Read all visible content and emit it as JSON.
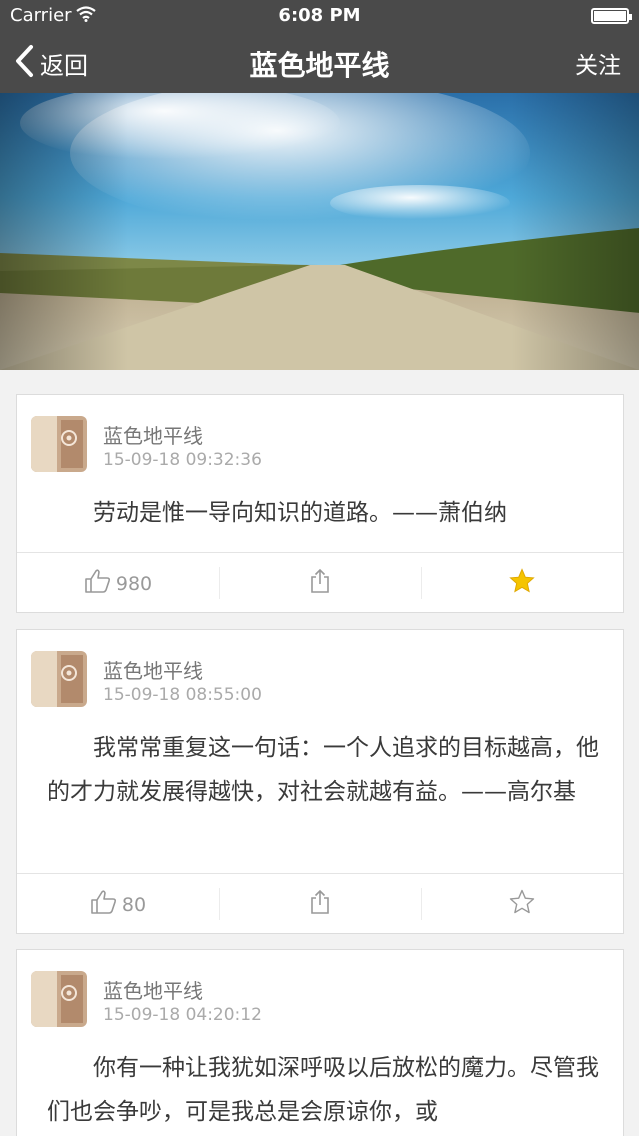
{
  "status_bar": {
    "carrier": "Carrier",
    "time": "6:08 PM"
  },
  "nav": {
    "back_label": "返回",
    "title": "蓝色地平线",
    "follow_label": "关注"
  },
  "posts": [
    {
      "author": "蓝色地平线",
      "time": "15-09-18 09:32:36",
      "content": "劳动是惟一导向知识的道路。——萧伯纳",
      "likes": "980",
      "favorited": true
    },
    {
      "author": "蓝色地平线",
      "time": "15-09-18 08:55:00",
      "content": "我常常重复这一句话：一个人追求的目标越高，他的才力就发展得越快，对社会就越有益。——高尔基",
      "likes": "80",
      "favorited": false
    },
    {
      "author": "蓝色地平线",
      "time": "15-09-18 04:20:12",
      "content": "你有一种让我犹如深呼吸以后放松的魔力。尽管我们也会争吵，可是我总是会原谅你，或",
      "likes": "",
      "favorited": false
    }
  ],
  "colors": {
    "nav_bg": "#4a4a4a",
    "star_active": "#f5c400",
    "page_bg": "#f2f2f2"
  }
}
